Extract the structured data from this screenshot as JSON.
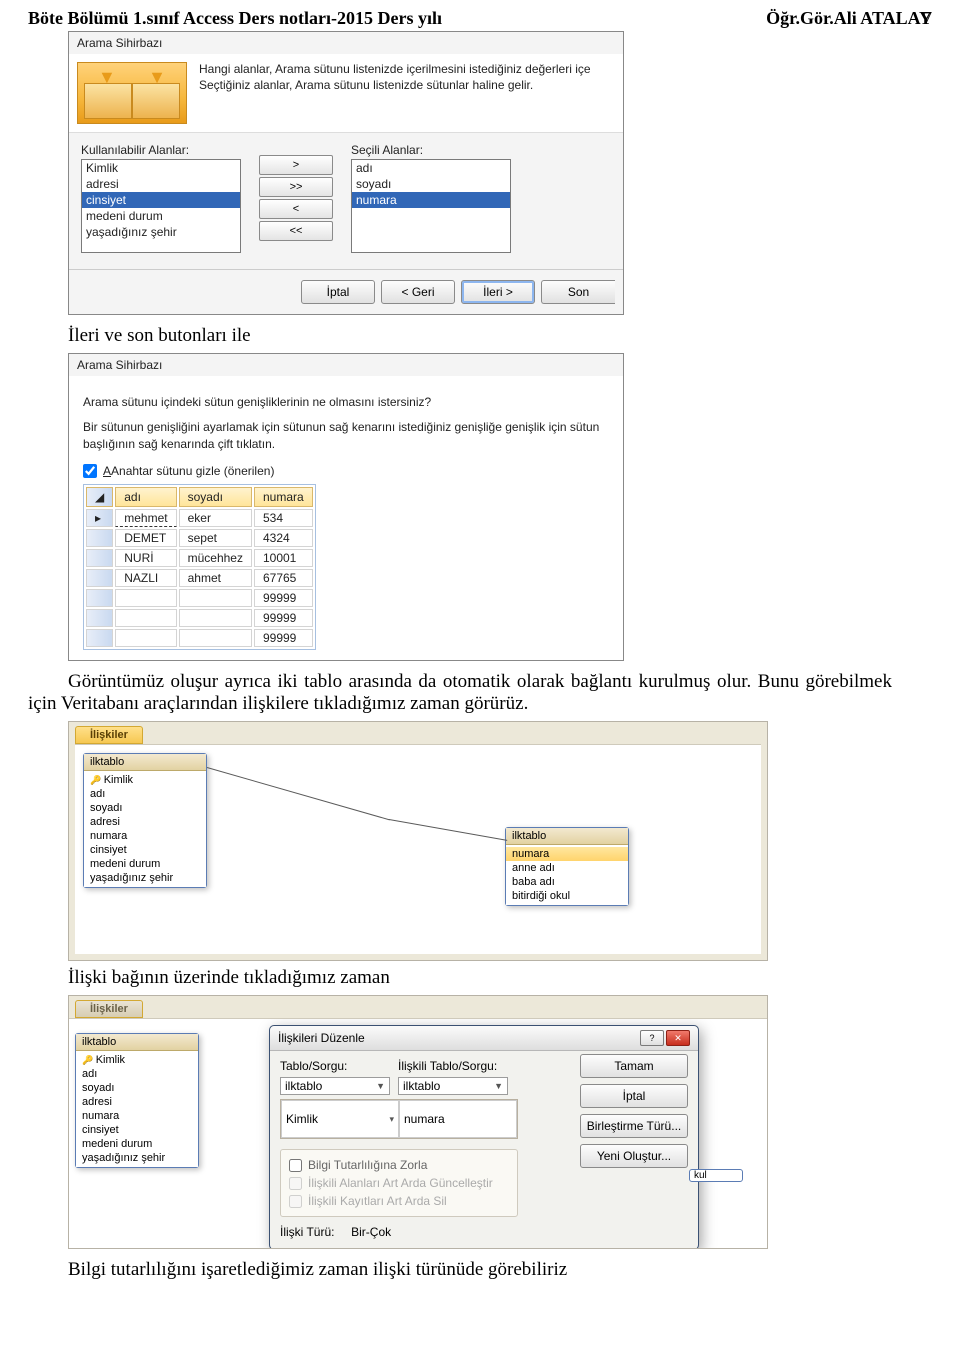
{
  "page_number": "7",
  "header": {
    "left": "Böte Bölümü 1.sınıf Access Ders notları-2015 Ders yılı",
    "right": "Öğr.Gör.Ali ATALAY"
  },
  "wizard1": {
    "title": "Arama Sihirbazı",
    "desc1": "Hangi alanlar, Arama sütunu listenizde içerilmesini istediğiniz değerleri içe",
    "desc2": "Seçtiğiniz alanlar, Arama sütunu listenizde sütunlar haline gelir.",
    "available_label": "Kullanılabilir Alanlar:",
    "selected_label": "Seçili Alanlar:",
    "available": [
      "Kimlik",
      "adresi",
      "cinsiyet",
      "medeni durum",
      "yaşadığınız şehir"
    ],
    "available_sel_index": 2,
    "selected": [
      "adı",
      "soyadı",
      "numara"
    ],
    "selected_sel_index": 2,
    "btns": {
      "add": ">",
      "add_all": ">>",
      "remove": "<",
      "remove_all": "<<"
    },
    "footer": {
      "iptal": "İptal",
      "geri": "< Geri",
      "ileri": "İleri >",
      "son": "Son"
    }
  },
  "text1": "İleri ve son butonları ile",
  "wizard2": {
    "title": "Arama Sihirbazı",
    "q": "Arama sütunu içindeki sütun genişliklerinin ne olmasını istersiniz?",
    "p": "Bir sütunun genişliğini ayarlamak için sütunun sağ kenarını istediğiniz genişliğe\ngenişlik için sütun başlığının sağ kenarında çift tıklatın.",
    "chk": "Anahtar sütunu gizle (önerilen)",
    "columns": [
      "adı",
      "soyadı",
      "numara"
    ],
    "rows": [
      [
        "mehmet",
        "eker",
        "534"
      ],
      [
        "DEMET",
        "sepet",
        "4324"
      ],
      [
        "NURİ",
        "mücehhez",
        "10001"
      ],
      [
        "NAZLI",
        "ahmet",
        "67765"
      ],
      [
        "",
        "",
        "99999"
      ],
      [
        "",
        "",
        "99999"
      ],
      [
        "",
        "",
        "99999"
      ]
    ]
  },
  "para1": "Görüntümüz oluşur ayrıca iki tablo arasında da otomatik olarak bağlantı kurulmuş olur. Bunu görebilmek için Veritabanı araçlarından ilişkilere tıkladığımız zaman görürüz.",
  "rel1": {
    "tab": "İlişkiler",
    "tableA": {
      "title": "ilktablo",
      "items": [
        "Kimlik",
        "adı",
        "soyadı",
        "adresi",
        "numara",
        "cinsiyet",
        "medeni durum",
        "yaşadığınız şehir"
      ],
      "pk_index": 0
    },
    "tableB": {
      "title": "ilktablo",
      "items": [
        "numara",
        "anne adı",
        "baba adı",
        "bitirdiği okul"
      ],
      "hl_index": 0
    }
  },
  "text2": "İlişki bağının üzerinde tıkladığımız zaman",
  "rel2": {
    "tab": "İlişkiler",
    "tableA": {
      "title": "ilktablo",
      "items": [
        "Kimlik",
        "adı",
        "soyadı",
        "adresi",
        "numara",
        "cinsiyet",
        "medeni durum",
        "yaşadığınız şehir"
      ],
      "pk_index": 0
    },
    "dialog": {
      "title": "İlişkileri Düzenle",
      "lbl_tablesorgu": "Tablo/Sorgu:",
      "lbl_related": "İlişkili Tablo/Sorgu:",
      "combo_left": "ilktablo",
      "combo_right": "ilktablo",
      "field_left": "Kimlik",
      "field_right": "numara",
      "chk1": "Bilgi Tutarlılığına Zorla",
      "chk2": "İlişkili Alanları Art Arda Güncelleştir",
      "chk3": "İlişkili Kayıtları Art Arda Sil",
      "relkind_label": "İlişki Türü:",
      "relkind_value": "Bir-Çok",
      "btns": {
        "tamam": "Tamam",
        "iptal": "İptal",
        "birtur": "Birleştirme Türü...",
        "yeni": "Yeni Oluştur..."
      }
    },
    "edge": {
      "title": "",
      "items": [
        "kul"
      ]
    }
  },
  "text3": "Bilgi tutarlılığını işaretlediğimiz zaman ilişki türünüde görebiliriz"
}
